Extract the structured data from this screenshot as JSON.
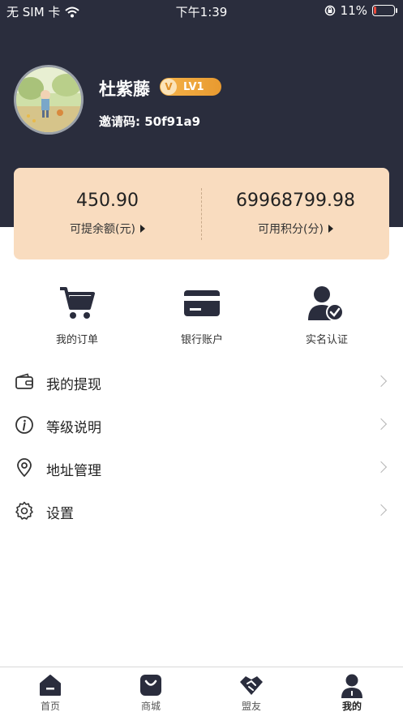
{
  "status_bar": {
    "carrier": "无 SIM 卡",
    "time": "下午1:39",
    "battery": "11%",
    "battery_level": 0.11
  },
  "profile": {
    "name": "杜紫藤",
    "level_badge": "LV1",
    "level_icon": "V",
    "invite": "邀请码: 50f91a9"
  },
  "balance": {
    "withdrawable_value": "450.90",
    "withdrawable_label": "可提余额(元)",
    "points_value": "69968799.98",
    "points_label": "可用积分(分)"
  },
  "quick_actions": [
    {
      "label": "我的订单",
      "icon": "cart-icon"
    },
    {
      "label": "银行账户",
      "icon": "bank-card-icon"
    },
    {
      "label": "实名认证",
      "icon": "verified-user-icon"
    }
  ],
  "menu": [
    {
      "label": "我的提现",
      "icon": "wallet-icon"
    },
    {
      "label": "等级说明",
      "icon": "info-icon"
    },
    {
      "label": "地址管理",
      "icon": "location-pin-icon"
    },
    {
      "label": "设置",
      "icon": "gear-icon"
    }
  ],
  "tabs": [
    {
      "label": "首页",
      "icon": "home-icon"
    },
    {
      "label": "商城",
      "icon": "shopping-bag-icon"
    },
    {
      "label": "盟友",
      "icon": "handshake-icon"
    },
    {
      "label": "我的",
      "icon": "user-icon",
      "active": true
    }
  ],
  "colors": {
    "header_bg": "#2a2d3d",
    "card_bg": "#f9dcbf",
    "badge": "#f0a83d",
    "battery_low": "#e84a3c"
  }
}
